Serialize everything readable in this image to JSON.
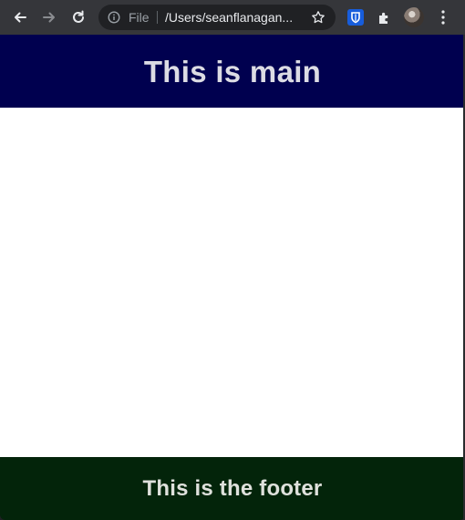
{
  "browser": {
    "omnibox": {
      "scheme_label": "File",
      "url": "/Users/seanflanagan..."
    },
    "icons": {
      "back": "arrow-left-icon",
      "forward": "arrow-right-icon",
      "reload": "reload-icon",
      "info": "info-icon",
      "bookmark": "star-icon",
      "extension_1": "bitwarden-shield-icon",
      "extensions": "puzzle-icon",
      "profile": "avatar",
      "menu": "kebab-menu-icon"
    }
  },
  "page": {
    "main_heading": "This is main",
    "footer_heading": "This is the footer"
  },
  "colors": {
    "toolbar": "#35363a",
    "omnibox": "#202124",
    "main_background": "#00004f",
    "content_background": "#ffffff",
    "footer_background": "#03240a",
    "heading_text": "#dcdce4"
  }
}
